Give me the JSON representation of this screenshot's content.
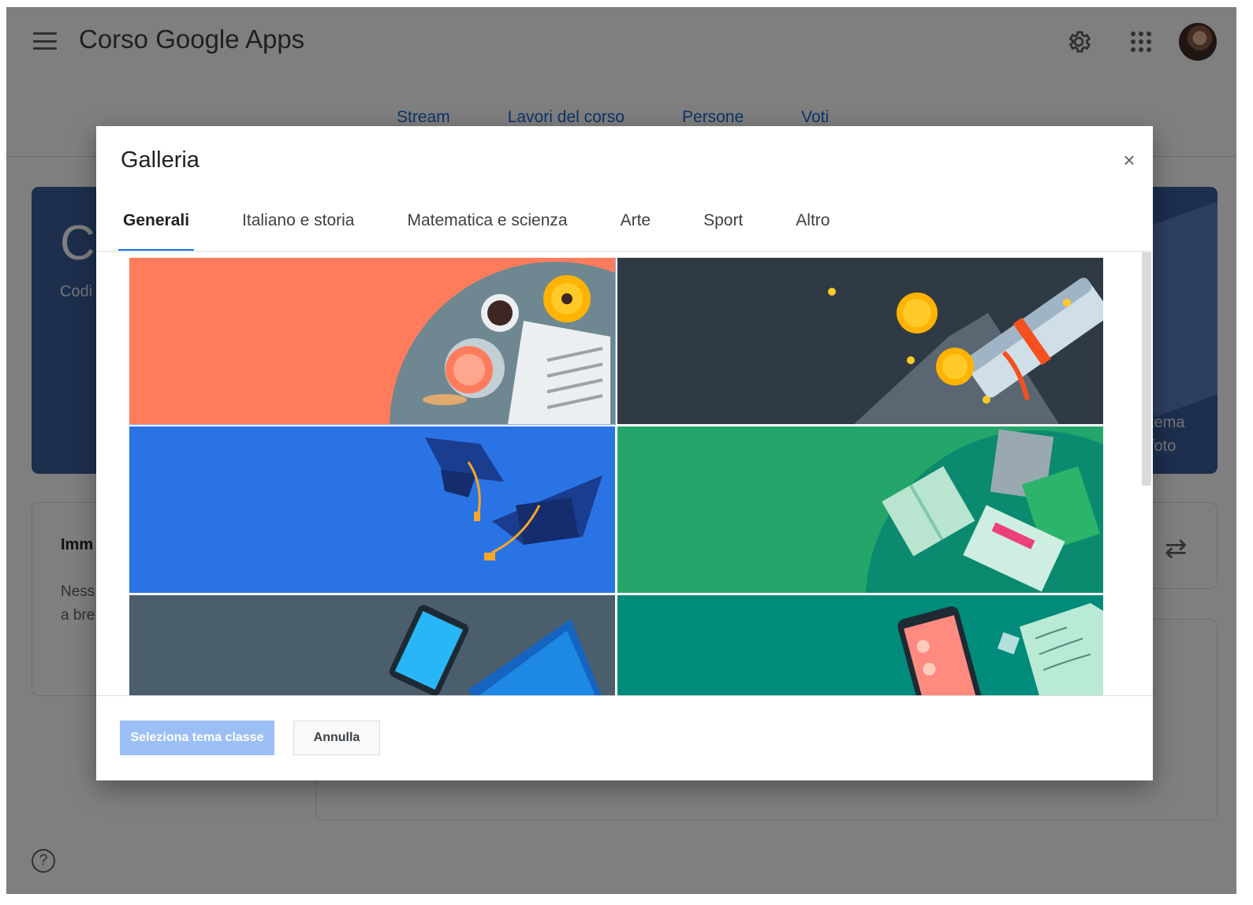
{
  "app": {
    "title": "Corso Google Apps",
    "nav_tabs": [
      "Stream",
      "Lavori del corso",
      "Persone",
      "Voti"
    ],
    "banner": {
      "big_letter": "C",
      "code_label": "Codi",
      "theme_text_1": "tema",
      "theme_text_2": "foto"
    },
    "card_left": {
      "title": "Imm",
      "body_1": "Ness",
      "body_2": "a bre"
    },
    "help": "?"
  },
  "icons": {
    "menu": "hamburger-menu-icon",
    "settings": "gear-icon",
    "apps": "apps-grid-icon",
    "swap": "swap-icon",
    "help": "help-circle-icon",
    "close": "close-icon"
  },
  "colors": {
    "accent": "#1a73e8",
    "primary_button_disabled": "#9bbff4",
    "tile_orange": "#fe7c5c",
    "tile_navy": "#2f3a44",
    "tile_blue": "#2a73e5",
    "tile_green": "#24a66a",
    "tile_slate": "#4b5e6b",
    "tile_teal": "#008b7a"
  },
  "dialog": {
    "title": "Galleria",
    "close": "×",
    "tabs": [
      {
        "label": "Generali",
        "active": true
      },
      {
        "label": "Italiano e storia",
        "active": false
      },
      {
        "label": "Matematica e scienza",
        "active": false
      },
      {
        "label": "Arte",
        "active": false
      },
      {
        "label": "Sport",
        "active": false
      },
      {
        "label": "Altro",
        "active": false
      }
    ],
    "tiles": [
      {
        "theme": "coffee-table",
        "color": "#fe7c5c",
        "selected": true
      },
      {
        "theme": "diploma-coins",
        "color": "#2f3a44",
        "selected": false
      },
      {
        "theme": "graduation-caps",
        "color": "#2a73e5",
        "selected": false
      },
      {
        "theme": "books",
        "color": "#24a66a",
        "selected": false
      },
      {
        "theme": "tablet-laptop",
        "color": "#4b5e6b",
        "selected": false
      },
      {
        "theme": "phone-notes",
        "color": "#008b7a",
        "selected": false
      }
    ],
    "primary_button": "Seleziona tema classe",
    "cancel_button": "Annulla"
  }
}
